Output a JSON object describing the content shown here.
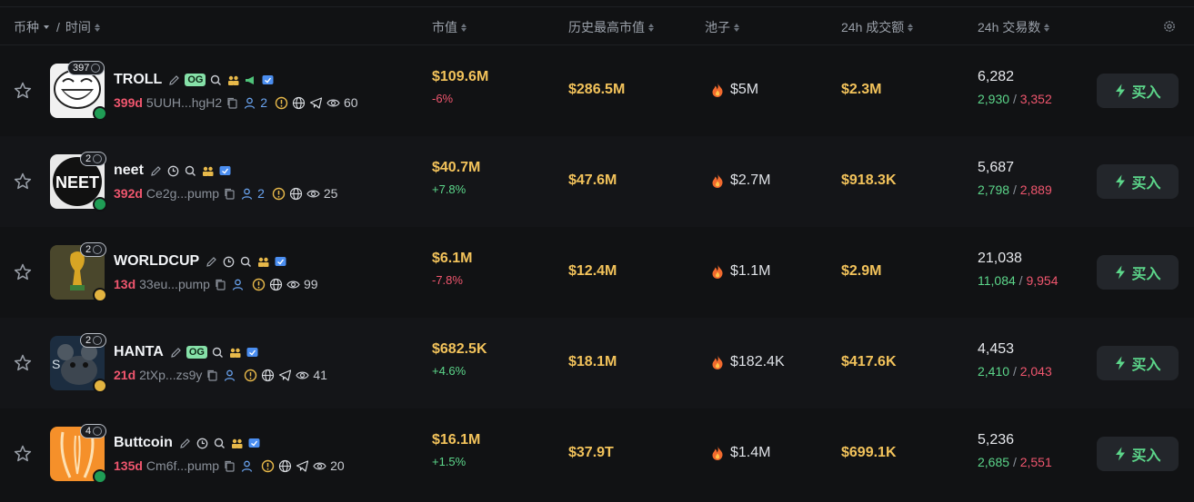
{
  "header": {
    "token_col": "币种",
    "sep": "/",
    "time_col": "时间",
    "mcap_col": "市值",
    "ath_col": "历史最高市值",
    "pool_col": "池子",
    "vol_col": "24h 成交额",
    "txs_col": "24h 交易数"
  },
  "colors": {
    "accent_gold": "#f3c35b",
    "up_green": "#5cd68a",
    "down_red": "#f0566e",
    "age_red": "#f0566e",
    "link_blue": "#6aa4f0"
  },
  "rows": [
    {
      "name": "TROLL",
      "og": "OG",
      "holders_badge": "397",
      "age": "399d",
      "address": "5UUH...hgH2",
      "holders_count": "2",
      "views": "60",
      "mcap": "$109.6M",
      "change": "-6%",
      "ath": "$286.5M",
      "pool": "$5M",
      "volume": "$2.3M",
      "txs": "6,282",
      "buys": "2,930",
      "sells": "3,352",
      "buy_label": "买入"
    },
    {
      "name": "neet",
      "og": "",
      "holders_badge": "2",
      "age": "392d",
      "address": "Ce2g...pump",
      "holders_count": "2",
      "views": "25",
      "mcap": "$40.7M",
      "change": "+7.8%",
      "ath": "$47.6M",
      "pool": "$2.7M",
      "volume": "$918.3K",
      "txs": "5,687",
      "buys": "2,798",
      "sells": "2,889",
      "buy_label": "买入"
    },
    {
      "name": "WORLDCUP",
      "og": "",
      "holders_badge": "2",
      "age": "13d",
      "address": "33eu...pump",
      "holders_count": "",
      "views": "99",
      "mcap": "$6.1M",
      "change": "-7.8%",
      "ath": "$12.4M",
      "pool": "$1.1M",
      "volume": "$2.9M",
      "txs": "21,038",
      "buys": "11,084",
      "sells": "9,954",
      "buy_label": "买入"
    },
    {
      "name": "HANTA",
      "og": "OG",
      "holders_badge": "2",
      "age": "21d",
      "address": "2tXp...zs9y",
      "holders_count": "",
      "views": "41",
      "mcap": "$682.5K",
      "change": "+4.6%",
      "ath": "$18.1M",
      "pool": "$182.4K",
      "volume": "$417.6K",
      "txs": "4,453",
      "buys": "2,410",
      "sells": "2,043",
      "buy_label": "买入"
    },
    {
      "name": "Buttcoin",
      "og": "",
      "holders_badge": "4",
      "age": "135d",
      "address": "Cm6f...pump",
      "holders_count": "",
      "views": "20",
      "mcap": "$16.1M",
      "change": "+1.5%",
      "ath": "$37.9T",
      "pool": "$1.4M",
      "volume": "$699.1K",
      "txs": "5,236",
      "buys": "2,685",
      "sells": "2,551",
      "buy_label": "买入"
    }
  ]
}
